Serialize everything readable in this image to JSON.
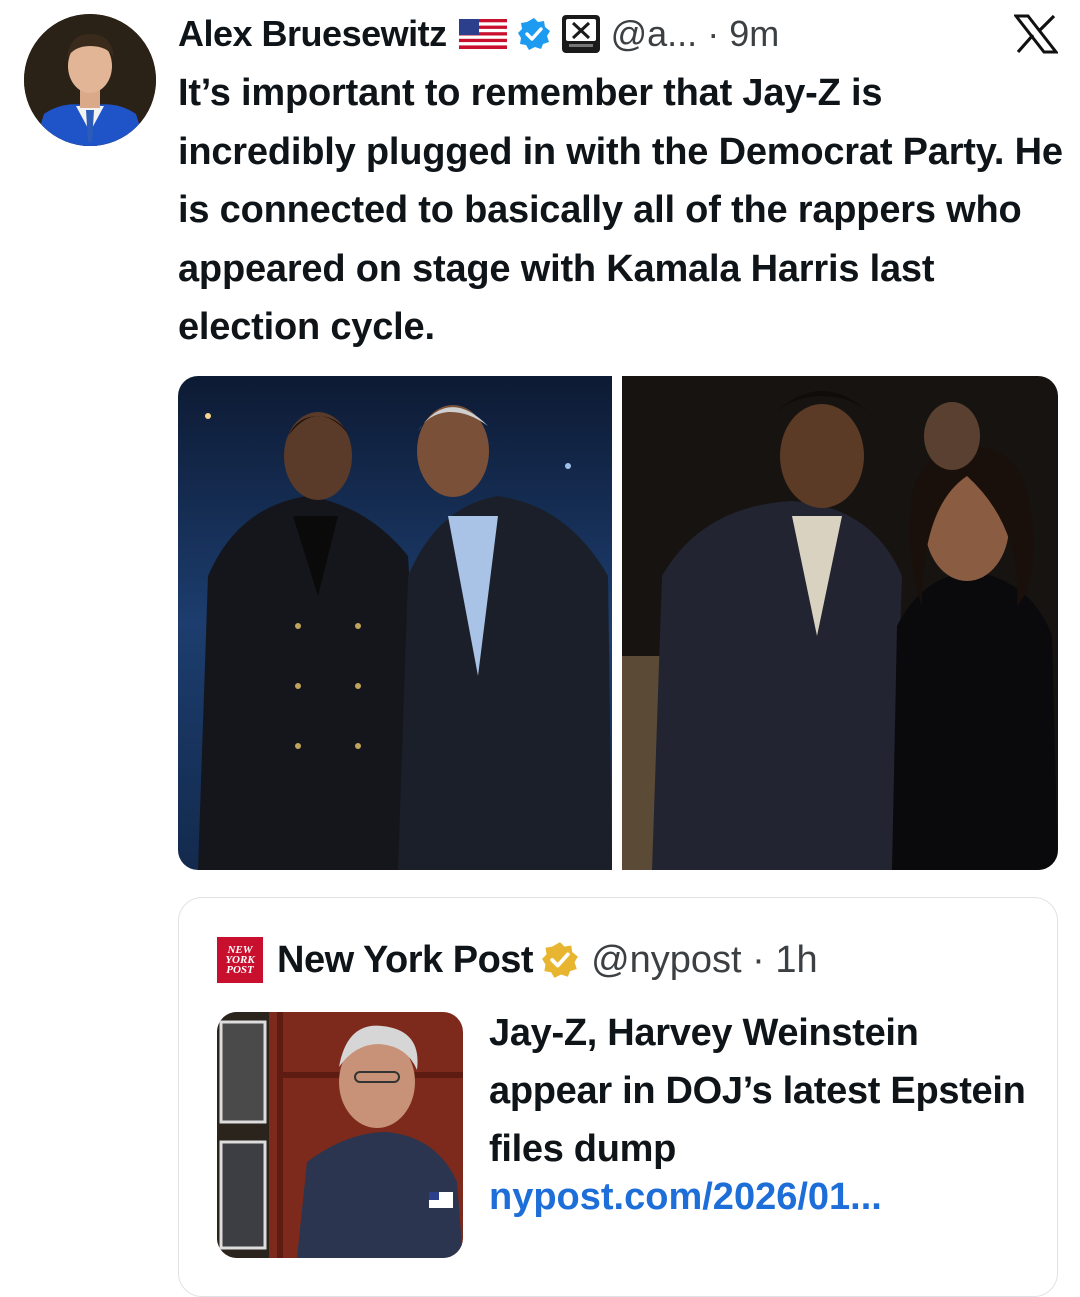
{
  "author": {
    "name": "Alex Bruesewitz",
    "handle": "@a...",
    "time": "9m",
    "flag_icon": "us-flag-icon",
    "verified_color": "#1d9bf0",
    "affiliate_badge": "X"
  },
  "platform": {
    "logo": "X"
  },
  "tweet": {
    "text": "It’s important to remember that Jay-Z is incredibly plugged in with the Democrat Party. He is connected to basically all of the rappers who appeared on stage with Kamala Harris last election cycle."
  },
  "media": {
    "count": 2,
    "photos": [
      "photo-1",
      "photo-2"
    ]
  },
  "quote": {
    "source_name": "New York Post",
    "source_logo_text": [
      "NEW",
      "YORK",
      "POST"
    ],
    "verified_color": "#e8b530",
    "handle": "@nypost",
    "time": "1h",
    "headline": "Jay-Z, Harvey Weinstein appear in DOJ’s latest Epstein files dump",
    "link": "nypost.com/2026/01..."
  },
  "colors": {
    "text": "#0f1419",
    "secondary": "#3c4043",
    "link": "#1d6ed8",
    "nypost_red": "#c8102e"
  }
}
